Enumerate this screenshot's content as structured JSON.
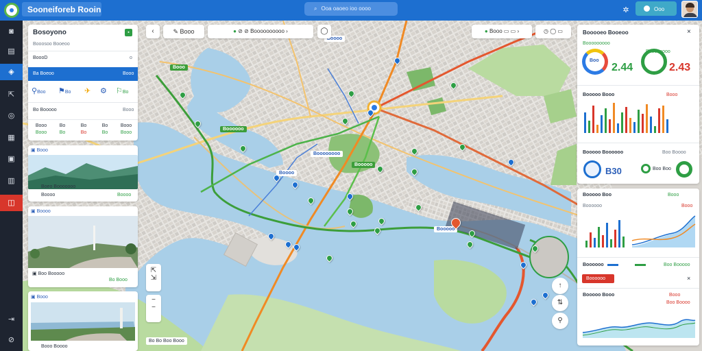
{
  "app": {
    "title": "Sooneiforeb Rooin",
    "search_placeholder": "Ooa oaoeo ioo oooo",
    "top_button": "Ooo"
  },
  "sidebar": {
    "icons": [
      "camera-icon",
      "inbox-icon",
      "route-icon",
      "export-icon",
      "compass-icon",
      "layers-icon",
      "clipboard-icon",
      "chart-icon",
      "basket-icon",
      "exit-icon",
      "settings-icon"
    ]
  },
  "panel": {
    "title": "Bosoyono",
    "sub": "Booosoo Booeoo",
    "row1": "BoooD",
    "row1_val": "o",
    "selected": "Ba Boeoo",
    "selected_val": "Booo",
    "icons_row": [
      {
        "label": "Boo"
      },
      {
        "label": "Bo"
      },
      {
        "label": ""
      },
      {
        "label": ""
      },
      {
        "label": "Bo"
      }
    ],
    "row3": "Bo Booooo",
    "row3_val": "Booo",
    "stats": [
      {
        "label": "Booo",
        "val": "Booo"
      },
      {
        "label": "Bo",
        "val": "Bo"
      },
      {
        "label": "Bo",
        "val": "Bo"
      },
      {
        "label": "Bo",
        "val": "Bo"
      },
      {
        "label": "Booo",
        "val": "Booo"
      }
    ]
  },
  "places": [
    {
      "title": "Booo",
      "name": "Boeo Booooooo",
      "sub": "Boooo",
      "price": "Boooo"
    },
    {
      "title": "Boooo",
      "name": "Boo Booooo",
      "sub": "",
      "price": "Bo Booo"
    },
    {
      "title": "Booo",
      "name": "Booo Boooo",
      "sub": "",
      "price": ""
    }
  ],
  "map_toolbar": {
    "filter": "Booo",
    "place": "Boooooooooo",
    "zoom": "Booo"
  },
  "map_labels": [
    "Booo",
    "Boooooo",
    "Booooo",
    "Boooo",
    "Boooo",
    "Boooooooo",
    "Booooo"
  ],
  "map_scale": "Bo  Bo  Boo  Booo",
  "right": {
    "header": "Booooeo Booeoo",
    "kpi_a_label": "Booooooooo",
    "kpi_a_value": "2.44",
    "kpi_a_inner": "Boo",
    "kpi_b_label": "Boooooooo",
    "kpi_b_value": "2.43",
    "chart1_title": "Booooo Booo",
    "chart1_tag": "Booo",
    "chart2_title": "Booooo Boooooo",
    "chart2_tag": "Boo Boooo",
    "gauge_value": "B30",
    "gauge_small": "Boo Boo",
    "card2_title": "Booooo Boo",
    "card2_tag": "Booo",
    "card2_sub": "Boooooo",
    "card2_red": "Booo",
    "legend_row": "Boooooo",
    "legend_val": "Boo Booooo",
    "red_button": "Boooooo",
    "card3_title": "Booooo Booo",
    "card3_tag": "Booo",
    "card3_val": "Boo Boooo"
  },
  "colors": {
    "accent": "#1d6fd0",
    "green": "#2e9e44",
    "red": "#d8362b",
    "orange": "#f08a24",
    "water": "#a9cfe8",
    "park": "#b9dba0"
  }
}
